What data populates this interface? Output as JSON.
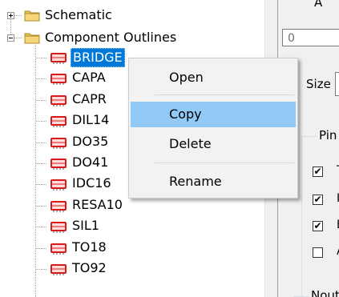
{
  "tree": {
    "root_items": [
      {
        "label": "Schematic",
        "expanded": false
      },
      {
        "label": "Component Outlines",
        "expanded": true
      }
    ],
    "children": [
      {
        "label": "BRIDGE",
        "selected": true
      },
      {
        "label": "CAPA"
      },
      {
        "label": "CAPR"
      },
      {
        "label": "DIL14"
      },
      {
        "label": "DO35"
      },
      {
        "label": "DO41"
      },
      {
        "label": "IDC16"
      },
      {
        "label": "RESA10"
      },
      {
        "label": "SIL1"
      },
      {
        "label": "TO18"
      },
      {
        "label": "TO92"
      }
    ]
  },
  "context_menu": {
    "items": [
      {
        "label": "Open"
      },
      {
        "label": "Copy",
        "highlighted": true
      },
      {
        "label": "Delete"
      },
      {
        "label": "Rename"
      }
    ]
  },
  "right_panel": {
    "top_field_value": "0",
    "size_label": "Size",
    "pin_group_label": "Pin",
    "checkboxes": [
      {
        "checked": true,
        "tail": "T"
      },
      {
        "checked": true,
        "tail": "I"
      },
      {
        "checked": true,
        "tail": "E"
      },
      {
        "checked": false,
        "tail": "A"
      }
    ],
    "bottom_group_label": "Nout",
    "top_partial_label": "A"
  },
  "colors": {
    "selection": "#0078d7",
    "menu_highlight": "#91c9f7",
    "menu_bg": "#f2f2f2",
    "panel_bg": "#f0f0f0",
    "component_icon": "#d41a1a"
  },
  "icons": {
    "expander_collapsed": "plus-box-icon",
    "expander_expanded": "minus-box-icon",
    "folder": "folder-icon",
    "component": "component-outline-icon"
  }
}
